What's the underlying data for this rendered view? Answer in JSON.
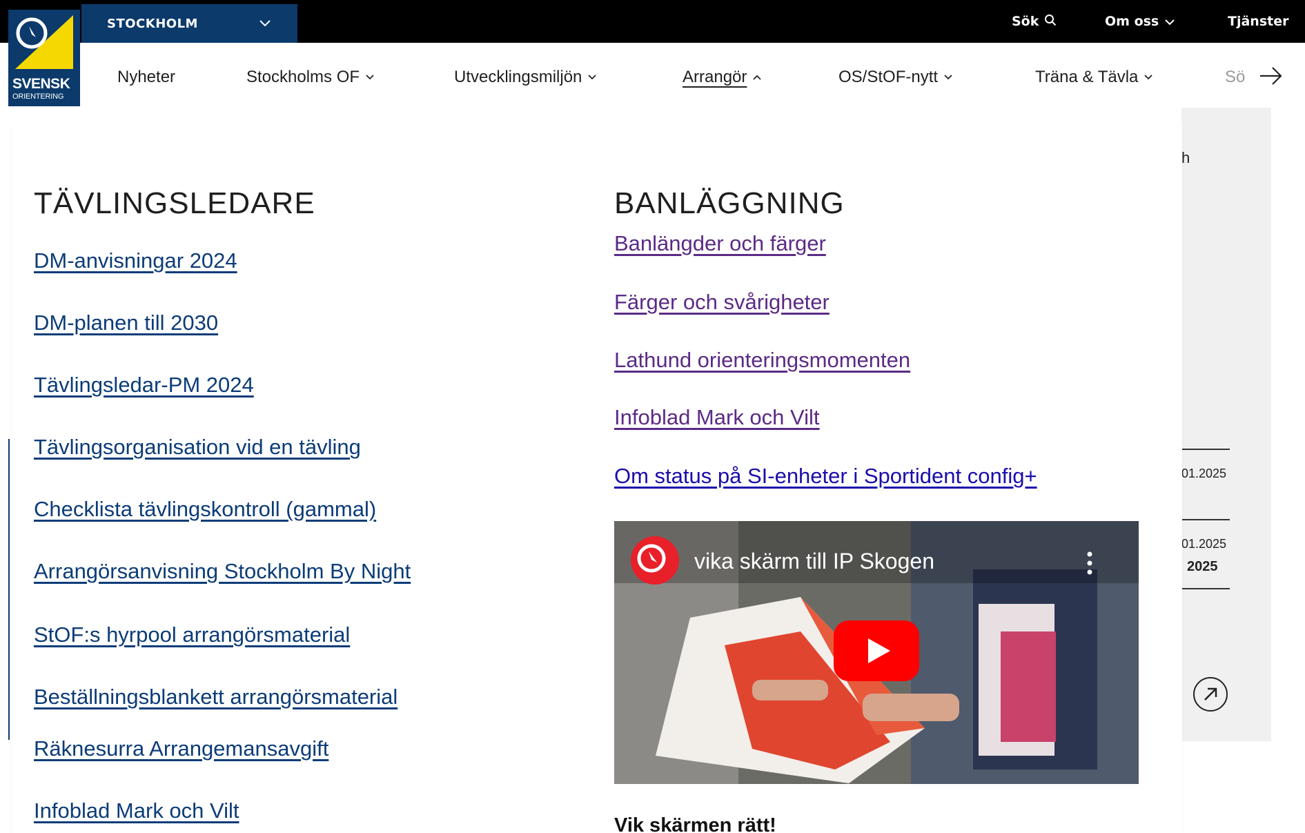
{
  "topbar": {
    "region_label": "STOCKHOLM",
    "search_label": "Sök",
    "about_label": "Om oss",
    "services_label": "Tjänster"
  },
  "logo": {
    "line1": "SVENSK",
    "line2": "ORIENTERING"
  },
  "mainnav": {
    "items": [
      {
        "label": "Nyheter"
      },
      {
        "label": "Stockholms OF"
      },
      {
        "label": "Utvecklingsmiljön"
      },
      {
        "label": "Arrangör"
      },
      {
        "label": "OS/StOF-nytt"
      },
      {
        "label": "Träna & Tävla"
      },
      {
        "label": "Sö"
      }
    ]
  },
  "background": {
    "h_char": "h",
    "date1": "01.2025",
    "date2": "01.2025",
    "year": "2025"
  },
  "dropdown": {
    "left": {
      "heading": "TÄVLINGSLEDARE",
      "links": [
        "DM-anvisningar 2024",
        "DM-planen till 2030",
        "Tävlingsledar-PM 2024",
        "Tävlingsorganisation vid en tävling",
        "Checklista tävlingskontroll (gammal)",
        "Arrangörsanvisning Stockholm By Night",
        "StOF:s hyrpool arrangörsmaterial",
        "Beställningsblankett arrangörsmaterial",
        "Räknesurra Arrangemansavgift",
        "Infoblad Mark och Vilt"
      ]
    },
    "right": {
      "heading": "BANLÄGGNING",
      "links": [
        "Banlängder och färger",
        "Färger och svårigheter",
        "Lathund orienteringsmomenten",
        "Infoblad Mark och Vilt",
        "Om status på SI-enheter i Sportident config+"
      ],
      "video_title": "vika skärm till IP Skogen",
      "video_caption": "Vik skärmen rätt!"
    }
  },
  "colors": {
    "brand_blue": "#0b3a6b",
    "brand_yellow": "#f5d800",
    "link_blue": "#0c3c78",
    "visited_purple": "#5b2a86",
    "youtube_red": "#ff0000"
  }
}
